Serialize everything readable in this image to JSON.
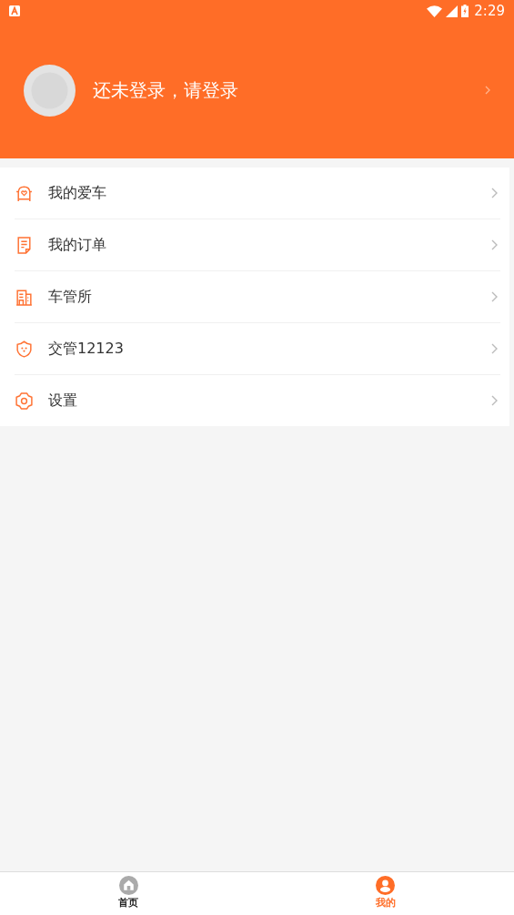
{
  "status_bar": {
    "time": "2:29"
  },
  "header": {
    "login_prompt": "还未登录，请登录"
  },
  "menu": [
    {
      "kind": "car",
      "label": "我的爱车"
    },
    {
      "kind": "order",
      "label": "我的订单"
    },
    {
      "kind": "office",
      "label": "车管所"
    },
    {
      "kind": "badge",
      "label": "交管12123"
    },
    {
      "kind": "settings",
      "label": "设置"
    }
  ],
  "bottom_nav": [
    {
      "kind": "home",
      "label": "首页",
      "selected": false
    },
    {
      "kind": "mine",
      "label": "我的",
      "selected": true
    }
  ]
}
